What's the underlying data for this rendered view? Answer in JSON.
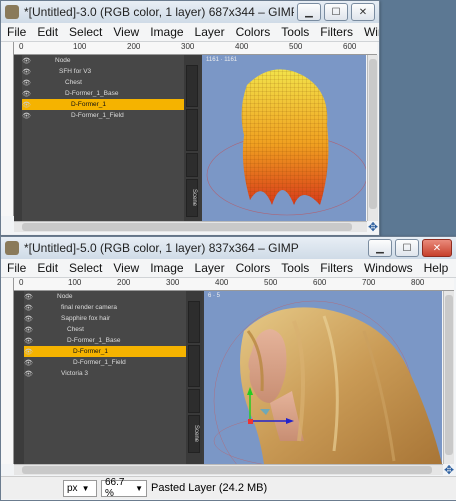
{
  "window1": {
    "title": "*[Untitled]-3.0 (RGB color, 1 layer) 687x344 – GIMP",
    "ruler_ticks": [
      "0",
      "100",
      "200",
      "300",
      "400",
      "500",
      "600"
    ],
    "viewport_label": "1161 · 1161",
    "layer_panel": {
      "rows": [
        {
          "label": "Node",
          "selected": false
        },
        {
          "label": "SFH for V3",
          "selected": false
        },
        {
          "label": "Chest",
          "selected": false
        },
        {
          "label": "D-Former_1_Base",
          "selected": false
        },
        {
          "label": "D-Former_1",
          "selected": true
        },
        {
          "label": "D-Former_1_Field",
          "selected": false
        }
      ],
      "side_tab": "Scene"
    }
  },
  "window2": {
    "title": "*[Untitled]-5.0 (RGB color, 1 layer) 837x364 – GIMP",
    "ruler_ticks": [
      "0",
      "100",
      "200",
      "300",
      "400",
      "500",
      "600",
      "700",
      "800"
    ],
    "viewport_label": "6 · 5",
    "layer_panel": {
      "rows": [
        {
          "label": "Node",
          "selected": false
        },
        {
          "label": "final render camera",
          "selected": false
        },
        {
          "label": "Sapphire fox hair",
          "selected": false
        },
        {
          "label": "Chest",
          "selected": false
        },
        {
          "label": "D-Former_1_Base",
          "selected": false
        },
        {
          "label": "D-Former_1",
          "selected": true
        },
        {
          "label": "D-Former_1_Field",
          "selected": false
        },
        {
          "label": "Victoria 3",
          "selected": false
        }
      ],
      "side_tab": "Scene"
    },
    "status": {
      "unit": "px",
      "zoom": "66.7 %",
      "message": "Pasted Layer (24.2 MB)"
    }
  },
  "menu": [
    "File",
    "Edit",
    "Select",
    "View",
    "Image",
    "Layer",
    "Colors",
    "Tools",
    "Filters",
    "Windows",
    "Help"
  ],
  "colors": {
    "selection": "#f5b300",
    "viewport_bg": "#7b97c6",
    "panel_bg": "#474747"
  }
}
